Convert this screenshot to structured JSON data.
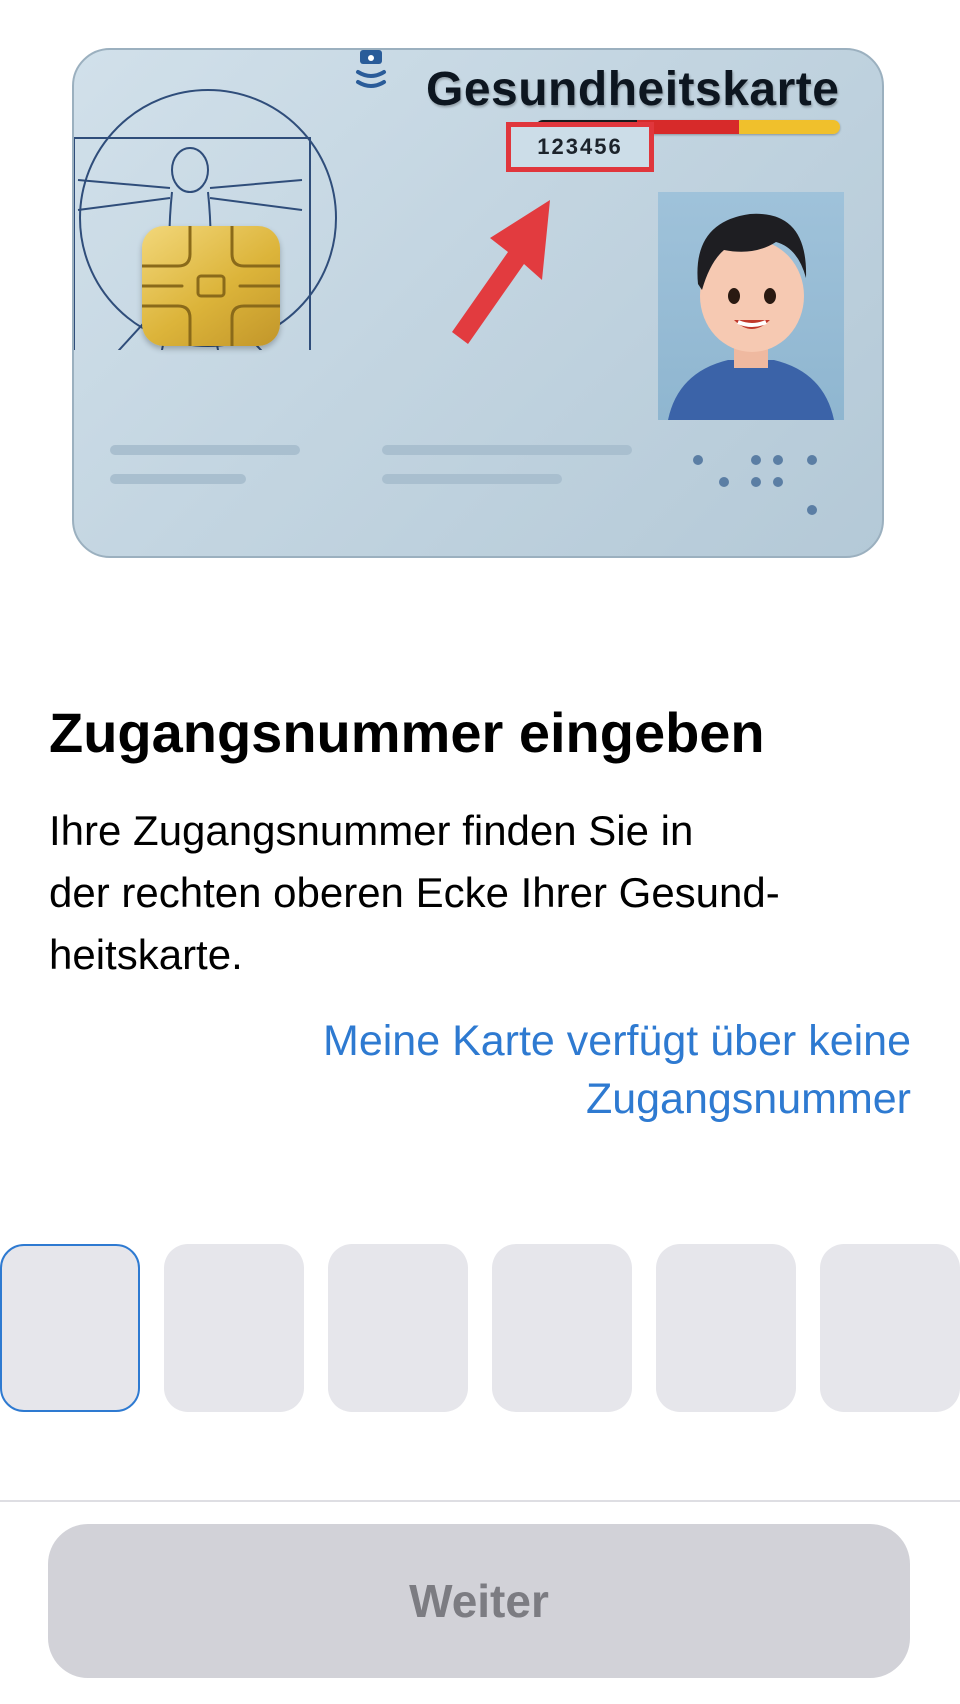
{
  "card": {
    "title": "Gesundheitskarte",
    "access_number": "123456",
    "accent_colors": {
      "highlight_box": "#e0363c",
      "arrow": "#e23b3f",
      "flag_black": "#1a1a1a",
      "flag_red": "#d72a2a",
      "flag_gold": "#f0c02c"
    },
    "icons": [
      "nfc-icon",
      "vitruvian-man-illustration",
      "chip-icon",
      "arrow-icon",
      "avatar-photo"
    ]
  },
  "heading": "Zugangsnummer eingeben",
  "description": "Ihre Zugangsnummer finden Sie in\nder rechten oberen Ecke Ihrer Gesund-\nheitskarte.",
  "no_number_link": "Meine Karte verfügt über keine Zugangsnummer",
  "code_input": {
    "length": 6,
    "values": [
      "",
      "",
      "",
      "",
      "",
      ""
    ],
    "active_index": 0,
    "active_border_color": "#2e7ad1"
  },
  "footer": {
    "next_label": "Weiter",
    "next_enabled": false
  },
  "colors": {
    "link": "#2e7ad1",
    "field_bg": "#e6e6eb",
    "disabled_button_bg": "#d2d2d8",
    "disabled_button_text": "#7c7c82"
  }
}
